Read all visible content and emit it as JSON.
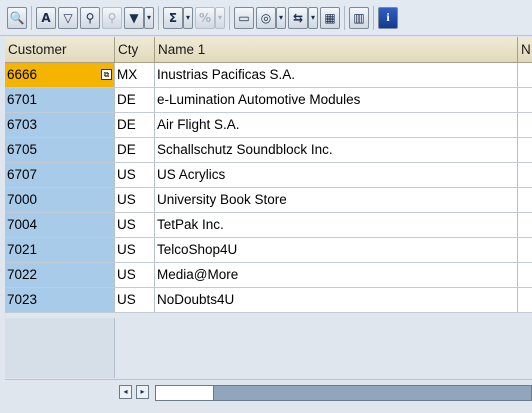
{
  "toolbar": {
    "buttons": [
      {
        "icon": "details-icon",
        "glyph": "🔍"
      },
      {
        "icon": "sort-ascending-icon",
        "glyph": "A"
      },
      {
        "icon": "filter-icon",
        "glyph": "▽"
      },
      {
        "icon": "find-icon",
        "glyph": "⚲"
      },
      {
        "icon": "find-next-icon",
        "glyph": "⚲"
      },
      {
        "icon": "set-filter-icon",
        "glyph": "▼"
      },
      {
        "icon": "total-icon",
        "glyph": "Σ"
      },
      {
        "icon": "subtotal-icon",
        "glyph": "%"
      },
      {
        "icon": "print-preview-icon",
        "glyph": "▭"
      },
      {
        "icon": "export-icon",
        "glyph": "◎"
      },
      {
        "icon": "spreadsheet-icon",
        "glyph": "⇆"
      },
      {
        "icon": "layout-grid-icon",
        "glyph": "▦"
      },
      {
        "icon": "change-layout-icon",
        "glyph": "▥"
      },
      {
        "icon": "info-icon",
        "glyph": "i"
      }
    ]
  },
  "grid": {
    "columns": [
      "Customer",
      "Cty",
      "Name 1",
      "N"
    ],
    "rows": [
      {
        "customer": "6666",
        "country": "MX",
        "name": "Inustrias Pacificas S.A."
      },
      {
        "customer": "6701",
        "country": "DE",
        "name": "e-Lumination Automotive Modules"
      },
      {
        "customer": "6703",
        "country": "DE",
        "name": "Air Flight S.A."
      },
      {
        "customer": "6705",
        "country": "DE",
        "name": "Schallschutz Soundblock Inc."
      },
      {
        "customer": "6707",
        "country": "US",
        "name": "US Acrylics"
      },
      {
        "customer": "7000",
        "country": "US",
        "name": "University Book Store"
      },
      {
        "customer": "7004",
        "country": "US",
        "name": "TetPak Inc."
      },
      {
        "customer": "7021",
        "country": "US",
        "name": "TelcoShop4U"
      },
      {
        "customer": "7022",
        "country": "US",
        "name": "Media@More"
      },
      {
        "customer": "7023",
        "country": "US",
        "name": "NoDoubts4U"
      }
    ]
  },
  "scrollbar": {
    "left_arrow": "◂",
    "right_arrow": "▸"
  },
  "colors": {
    "key_column": "#a7cbe9",
    "selected_cell": "#f5b400",
    "header": "#e9e1c8"
  }
}
